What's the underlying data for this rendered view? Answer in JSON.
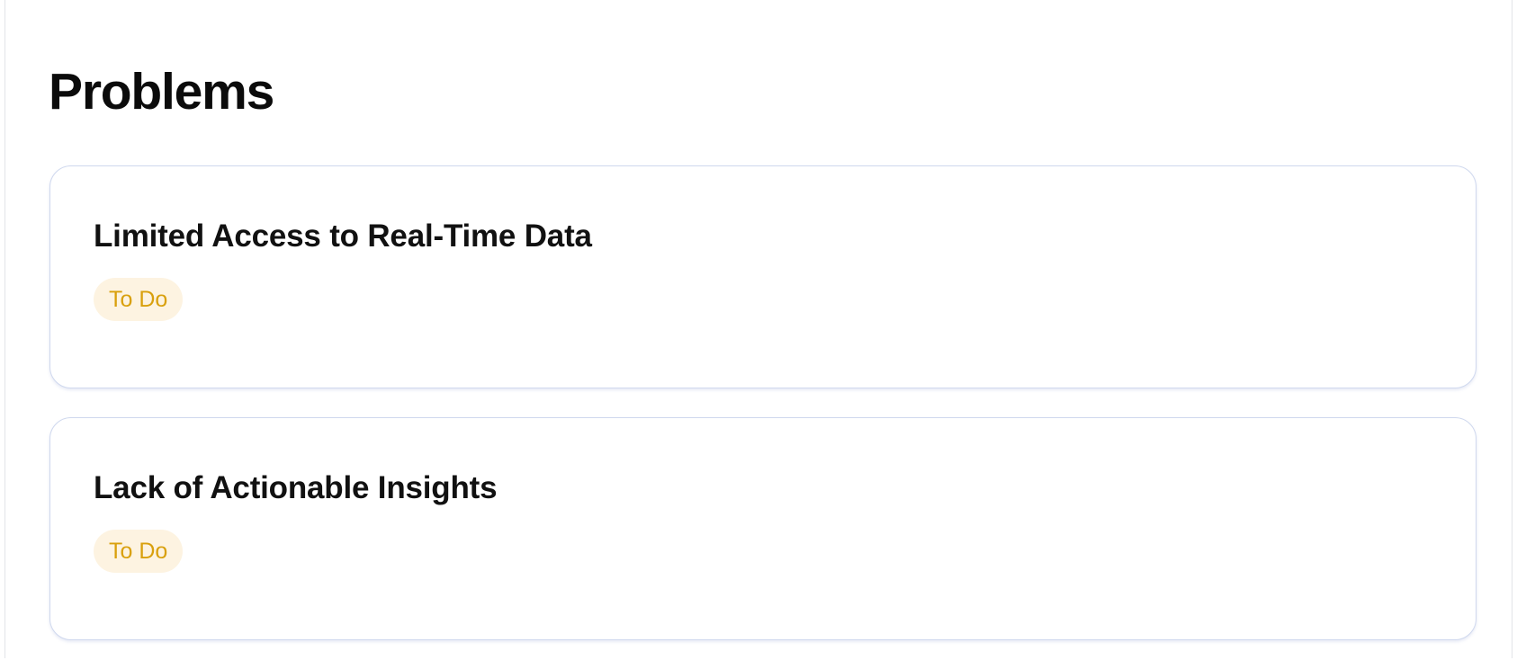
{
  "page": {
    "title": "Problems"
  },
  "problems": [
    {
      "title": "Limited Access to Real-Time Data",
      "status": "To Do"
    },
    {
      "title": "Lack of Actionable Insights",
      "status": "To Do"
    }
  ],
  "colors": {
    "status_todo_text": "#d9a00d",
    "status_todo_bg": "#fdf3e1",
    "card_border": "#cfd8ee"
  }
}
